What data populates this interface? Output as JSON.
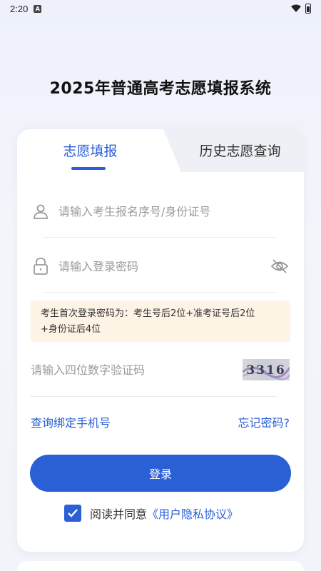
{
  "status_bar": {
    "time": "2:20",
    "notif_badge": "A"
  },
  "page": {
    "title": "2025年普通高考志愿填报系统"
  },
  "tabs": [
    {
      "label": "志愿填报",
      "active": true
    },
    {
      "label": "历史志愿查询",
      "active": false
    }
  ],
  "form": {
    "id_field": {
      "placeholder": "请输入考生报名序号/身份证号",
      "value": "",
      "icon": "user-icon"
    },
    "password_field": {
      "placeholder": "请输入登录密码",
      "value": "",
      "icon": "lock-icon",
      "toggle_icon": "eye-off-icon"
    },
    "hint_line1": "考生首次登录密码为：考生号后2位+准考证号后2位",
    "hint_line2": "+身份证后4位",
    "captcha_field": {
      "placeholder": "请输入四位数字验证码",
      "value": ""
    },
    "captcha_code": "3316"
  },
  "links": {
    "bind_phone": "查询绑定手机号",
    "forgot_password": "忘记密码?"
  },
  "login_button": "登录",
  "agreement": {
    "prefix": "阅读并同意",
    "link": "《用户隐私协议》",
    "checked": true
  },
  "colors": {
    "accent": "#2a5fd6",
    "hint_bg": "#fdf4e6",
    "background": "#eef1fb"
  }
}
